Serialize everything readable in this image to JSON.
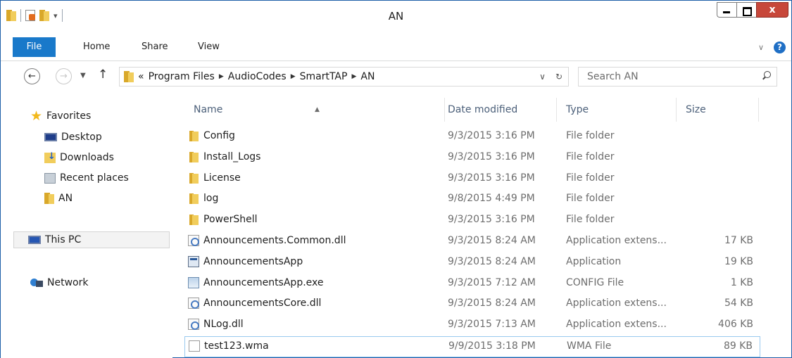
{
  "window": {
    "title": "AN"
  },
  "ribbon": {
    "tabs": [
      "File",
      "Home",
      "Share",
      "View"
    ]
  },
  "address": {
    "overflow": "«",
    "crumbs": [
      "Program Files",
      "AudioCodes",
      "SmartTAP",
      "AN"
    ],
    "search_placeholder": "Search AN"
  },
  "nav": {
    "favorites": "Favorites",
    "desktop": "Desktop",
    "downloads": "Downloads",
    "recent_places": "Recent places",
    "an": "AN",
    "this_pc": "This PC",
    "network": "Network"
  },
  "columns": {
    "name": "Name",
    "date": "Date modified",
    "type": "Type",
    "size": "Size"
  },
  "files": [
    {
      "name": "Config",
      "date": "9/3/2015 3:16 PM",
      "type": "File folder",
      "size": "",
      "icon": "folder"
    },
    {
      "name": "Install_Logs",
      "date": "9/3/2015 3:16 PM",
      "type": "File folder",
      "size": "",
      "icon": "folder"
    },
    {
      "name": "License",
      "date": "9/3/2015 3:16 PM",
      "type": "File folder",
      "size": "",
      "icon": "folder"
    },
    {
      "name": "log",
      "date": "9/8/2015 4:49 PM",
      "type": "File folder",
      "size": "",
      "icon": "folder"
    },
    {
      "name": "PowerShell",
      "date": "9/3/2015 3:16 PM",
      "type": "File folder",
      "size": "",
      "icon": "folder"
    },
    {
      "name": "Announcements.Common.dll",
      "date": "9/3/2015 8:24 AM",
      "type": "Application extens...",
      "size": "17 KB",
      "icon": "dll"
    },
    {
      "name": "AnnouncementsApp",
      "date": "9/3/2015 8:24 AM",
      "type": "Application",
      "size": "19 KB",
      "icon": "app"
    },
    {
      "name": "AnnouncementsApp.exe",
      "date": "9/3/2015 7:12 AM",
      "type": "CONFIG File",
      "size": "1 KB",
      "icon": "config"
    },
    {
      "name": "AnnouncementsCore.dll",
      "date": "9/3/2015 8:24 AM",
      "type": "Application extens...",
      "size": "54 KB",
      "icon": "dll"
    },
    {
      "name": "NLog.dll",
      "date": "9/3/2015 7:13 AM",
      "type": "Application extens...",
      "size": "406 KB",
      "icon": "dll"
    },
    {
      "name": "test123.wma",
      "date": "9/9/2015 3:18 PM",
      "type": "WMA File",
      "size": "89 KB",
      "icon": "file"
    }
  ]
}
